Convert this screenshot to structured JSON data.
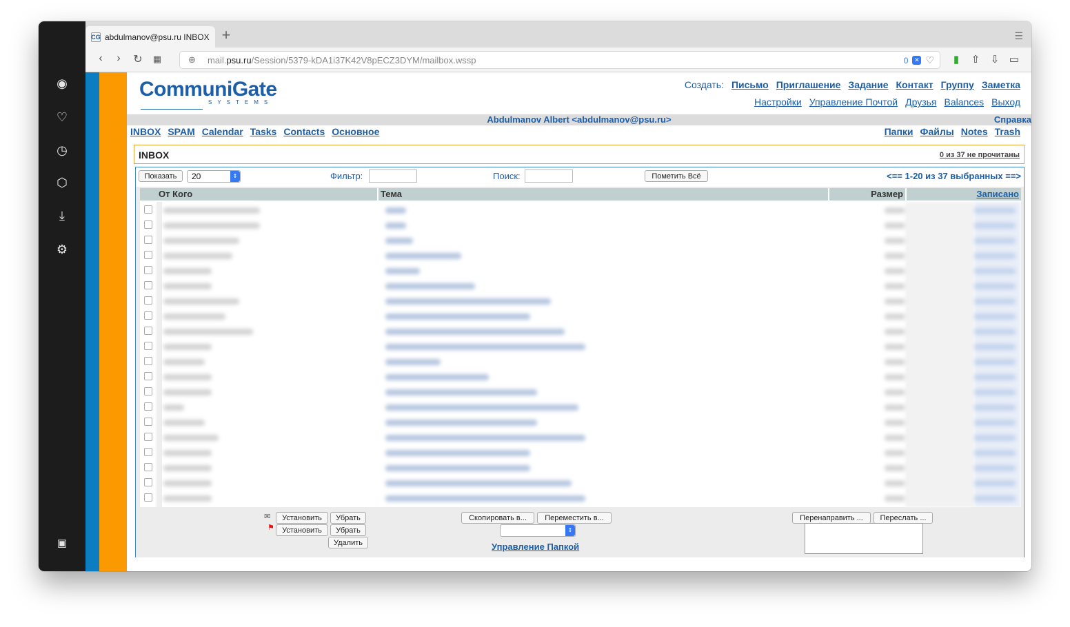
{
  "browser": {
    "tab_title": "abdulmanov@psu.ru INBOX",
    "tab_favicon": "CG",
    "new_tab": "+",
    "url_prefix": "mail.",
    "url_domain": "psu.ru",
    "url_path": "/Session/5379-kDA1i37K42V8pECZ3DYM/mailbox.wssp",
    "tracker_count": "0"
  },
  "logo": {
    "text": "CommuniGate",
    "sub": "SYSTEMS"
  },
  "top_links": {
    "create_label": "Создать:",
    "create": [
      "Письмо",
      "Приглашение",
      "Задание",
      "Контакт",
      "Группу",
      "Заметка"
    ],
    "settings": [
      "Настройки",
      "Управление Почтой",
      "Друзья",
      "Balances",
      "Выход"
    ]
  },
  "user": {
    "name": "Abdulmanov Albert <abdulmanov@psu.ru>",
    "help": "Справка"
  },
  "nav_left": [
    "INBOX",
    "SPAM",
    "Calendar",
    "Tasks",
    "Contacts",
    "Основное"
  ],
  "nav_right": [
    "Папки",
    "Файлы",
    "Notes",
    "Trash"
  ],
  "inbox": {
    "title": "INBOX",
    "unread": "0 из 37 не прочитаны"
  },
  "controls": {
    "show_button": "Показать",
    "page_size": "20",
    "filter_label": "Фильтр:",
    "search_label": "Поиск:",
    "mark_all": "Пометить Всё",
    "pager": "<== 1-20 из 37 выбранных ==>"
  },
  "table": {
    "columns": {
      "from": "От Кого",
      "subject": "Тема",
      "size": "Размер",
      "date": "Записано"
    }
  },
  "bottom": {
    "set": "Установить",
    "remove": "Убрать",
    "delete": "Удалить",
    "copy": "Скопировать в...",
    "move": "Переместить в...",
    "manage": "Управление Папкой",
    "redirect": "Перенаправить ...",
    "forward": "Переслать ..."
  }
}
